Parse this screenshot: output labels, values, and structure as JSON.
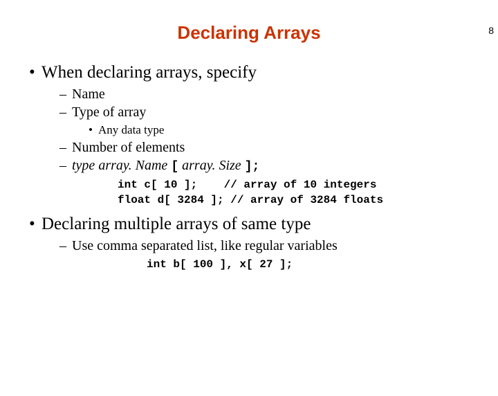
{
  "page_number": "8",
  "title": "Declaring Arrays",
  "title_color": "#cc3300",
  "bullets": {
    "b1a": "When declaring arrays, specify",
    "b2_name": "Name",
    "b2_type": "Type of array",
    "b3_any": "Any data type",
    "b2_num": "Number of elements",
    "b2_syntax_type": "type",
    "b2_syntax_arrname": "array. Name",
    "b2_syntax_open": "[",
    "b2_syntax_size": "array. Size",
    "b2_syntax_close": "];",
    "code1_line1": "int c[ 10 ];    // array of 10 integers",
    "code1_line2": "float d[ 3284 ]; // array of 3284 floats",
    "b1b": "Declaring multiple arrays of same type",
    "b2_comma": "Use comma separated list, like regular variables",
    "code2_line1": "int b[ 100 ], x[ 27 ];"
  }
}
